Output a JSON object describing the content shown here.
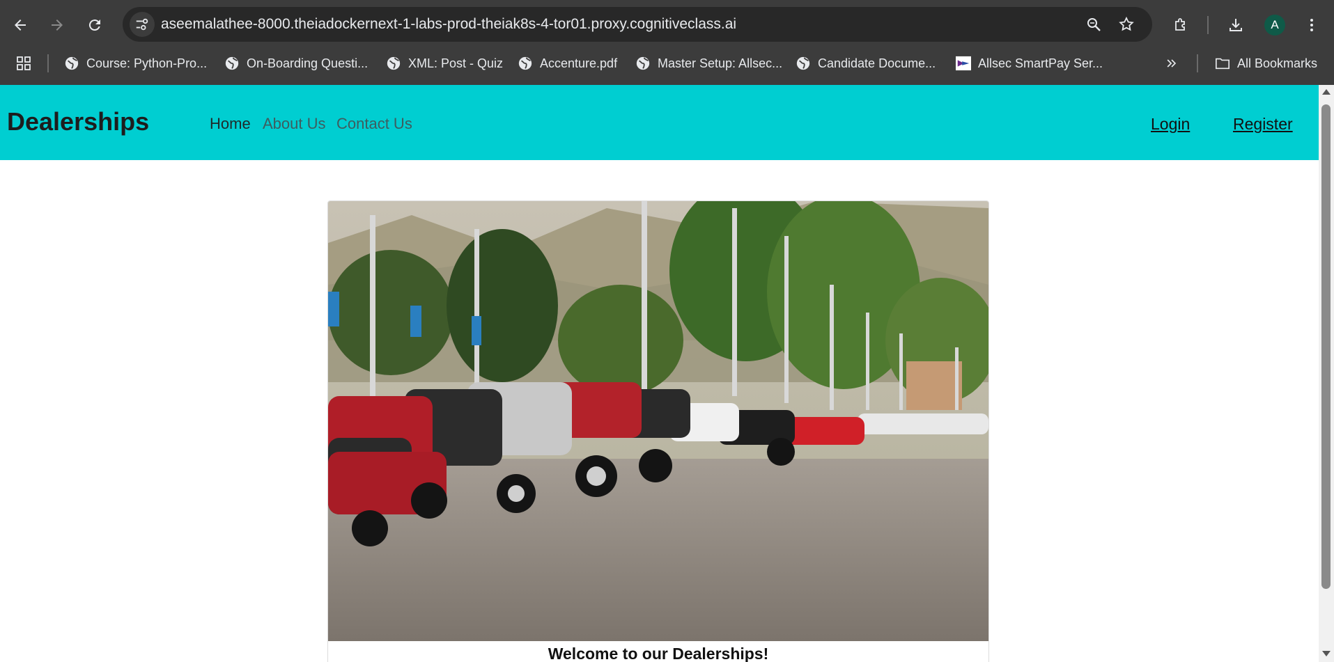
{
  "browser": {
    "url": "aseemalathee-8000.theiadockernext-1-labs-prod-theiak8s-4-tor01.proxy.cognitiveclass.ai",
    "profile_initial": "A",
    "bookmarks": [
      {
        "label": "Course: Python-Pro...",
        "icon": "globe-icon"
      },
      {
        "label": "On-Boarding Questi...",
        "icon": "globe-icon"
      },
      {
        "label": "XML: Post - Quiz",
        "icon": "globe-icon"
      },
      {
        "label": "Accenture.pdf",
        "icon": "globe-icon"
      },
      {
        "label": "Master Setup: Allsec...",
        "icon": "globe-icon"
      },
      {
        "label": "Candidate Docume...",
        "icon": "globe-icon"
      },
      {
        "label": "Allsec SmartPay Ser...",
        "icon": "allsec-logo-icon"
      }
    ],
    "all_bookmarks_label": "All Bookmarks"
  },
  "site": {
    "brand": "Dealerships",
    "nav": {
      "home": "Home",
      "about": "About Us",
      "contact": "Contact Us"
    },
    "auth": {
      "login": "Login",
      "register": "Register"
    },
    "colors": {
      "navbar": "#00ced1"
    },
    "welcome": "Welcome to our Dealerships!"
  }
}
